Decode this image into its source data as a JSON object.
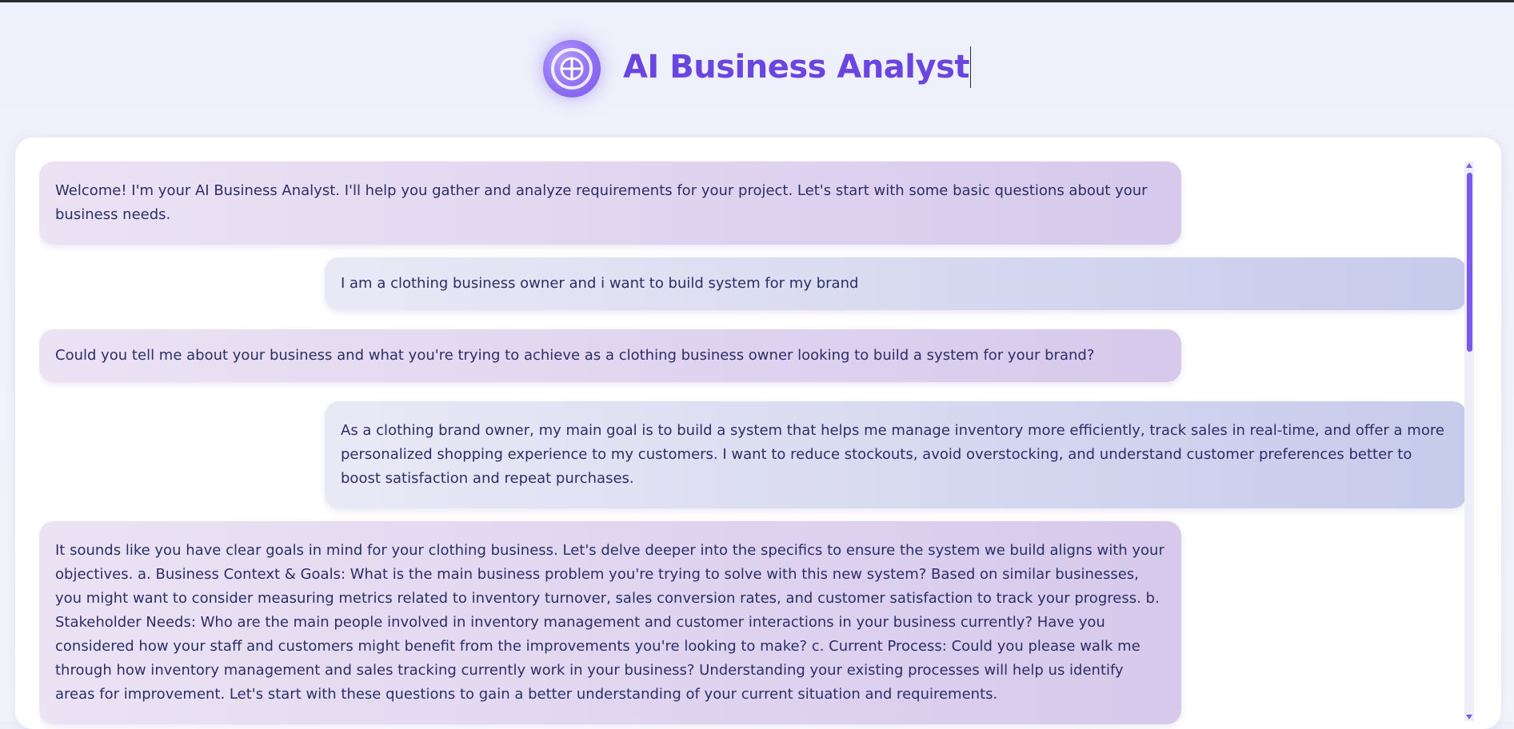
{
  "header": {
    "title": "AI Business Analyst",
    "logo_icon": "ai-compass-icon",
    "accent_color": "#6a45e0"
  },
  "messages": [
    {
      "role": "assistant",
      "text": "Welcome! I'm your AI Business Analyst. I'll help you gather and analyze requirements for your project. Let's start with some basic questions about your business needs."
    },
    {
      "role": "user",
      "text": "I am a clothing business owner and i want to build system for my brand"
    },
    {
      "role": "assistant",
      "text": "Could you tell me about your business and what you're trying to achieve as a clothing business owner looking to build a system for your brand?"
    },
    {
      "role": "user",
      "text": "As a clothing brand owner, my main goal is to build a system that helps me manage inventory more efficiently, track sales in real-time, and offer a more personalized shopping experience to my customers. I want to reduce stockouts, avoid overstocking, and understand customer preferences better to boost satisfaction and repeat purchases."
    },
    {
      "role": "assistant",
      "text": "It sounds like you have clear goals in mind for your clothing business. Let's delve deeper into the specifics to ensure the system we build aligns with your objectives. a. Business Context & Goals: What is the main business problem you're trying to solve with this new system? Based on similar businesses, you might want to consider measuring metrics related to inventory turnover, sales conversion rates, and customer satisfaction to track your progress. b. Stakeholder Needs: Who are the main people involved in inventory management and customer interactions in your business currently? Have you considered how your staff and customers might benefit from the improvements you're looking to make? c. Current Process: Could you please walk me through how inventory management and sales tracking currently work in your business? Understanding your existing processes will help us identify areas for improvement. Let's start with these questions to gain a better understanding of your current situation and requirements."
    }
  ],
  "colors": {
    "assistant_bubble": "#d6c9ec",
    "user_bubble": "#c7cbeb",
    "text": "#2c2e66",
    "scrollbar_thumb": "#7d56ec"
  }
}
